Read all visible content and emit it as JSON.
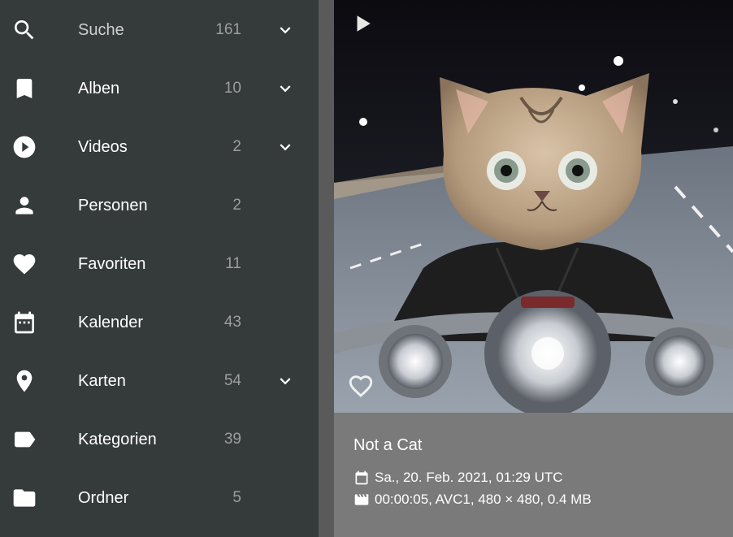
{
  "sidebar": {
    "items": [
      {
        "label": "Suche",
        "count": "161",
        "icon": "search-icon",
        "expandable": true
      },
      {
        "label": "Alben",
        "count": "10",
        "icon": "bookmark-icon",
        "expandable": true
      },
      {
        "label": "Videos",
        "count": "2",
        "icon": "play-circle-icon",
        "expandable": true
      },
      {
        "label": "Personen",
        "count": "2",
        "icon": "person-icon",
        "expandable": false
      },
      {
        "label": "Favoriten",
        "count": "11",
        "icon": "heart-icon",
        "expandable": false
      },
      {
        "label": "Kalender",
        "count": "43",
        "icon": "calendar-icon",
        "expandable": false
      },
      {
        "label": "Karten",
        "count": "54",
        "icon": "map-marker-icon",
        "expandable": true
      },
      {
        "label": "Kategorien",
        "count": "39",
        "icon": "label-icon",
        "expandable": false
      },
      {
        "label": "Ordner",
        "count": "5",
        "icon": "folder-icon",
        "expandable": false
      }
    ]
  },
  "card": {
    "title": "Not a Cat",
    "date": "Sa., 20. Feb. 2021, 01:29 UTC",
    "video_info": "00:00:05, AVC1, 480 × 480, 0.4 MB",
    "favorite": false
  },
  "colors": {
    "sidebar_bg": "#353a3a",
    "card_bg": "#7a7a7a",
    "count_text": "#9e9e9e"
  }
}
